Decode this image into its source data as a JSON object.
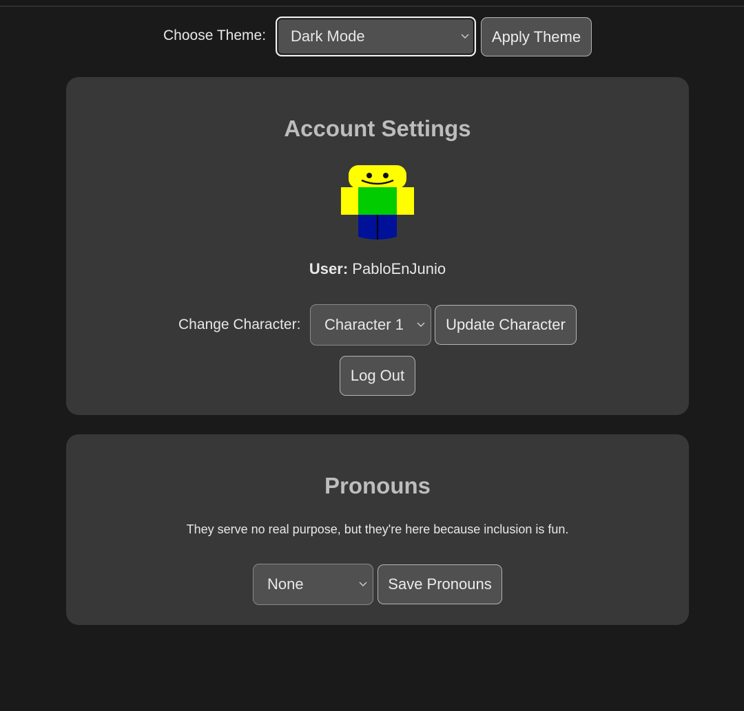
{
  "theme": {
    "label": "Choose Theme:",
    "selected": "Dark Mode",
    "apply_label": "Apply Theme"
  },
  "account": {
    "title": "Account Settings",
    "user_label": "User:",
    "username": "PabloEnJunio",
    "change_character_label": "Change Character:",
    "character_selected": "Character 1",
    "update_label": "Update Character",
    "logout_label": "Log Out"
  },
  "pronouns": {
    "title": "Pronouns",
    "description": "They serve no real purpose, but they're here because inclusion is fun.",
    "selected": "None",
    "save_label": "Save Pronouns"
  },
  "colors": {
    "background": "#1a1a1a",
    "card": "#383838",
    "control": "#505050",
    "title": "#bdbdbd"
  }
}
